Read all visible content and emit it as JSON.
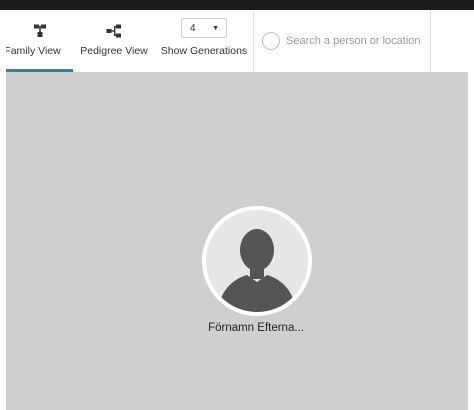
{
  "toolbar": {
    "family_view_label": "Family View",
    "pedigree_view_label": "Pedigree View",
    "generations_value": "4",
    "generations_label": "Show Generations",
    "search_placeholder": "Search a person or location"
  },
  "person": {
    "name": "Förnamn Efterna..."
  },
  "colors": {
    "accent": "#1d8ca0",
    "canvas": "#cfcfcf",
    "ring_arc_teal": "#5b9aa6",
    "ring_arc_green": "#8cb0a8",
    "ring_arc_tan": "#b9a596"
  },
  "icons": {
    "family_view": "family-tree-icon",
    "pedigree_view": "pedigree-icon",
    "search": "search-icon",
    "avatar": "person-silhouette-icon"
  }
}
